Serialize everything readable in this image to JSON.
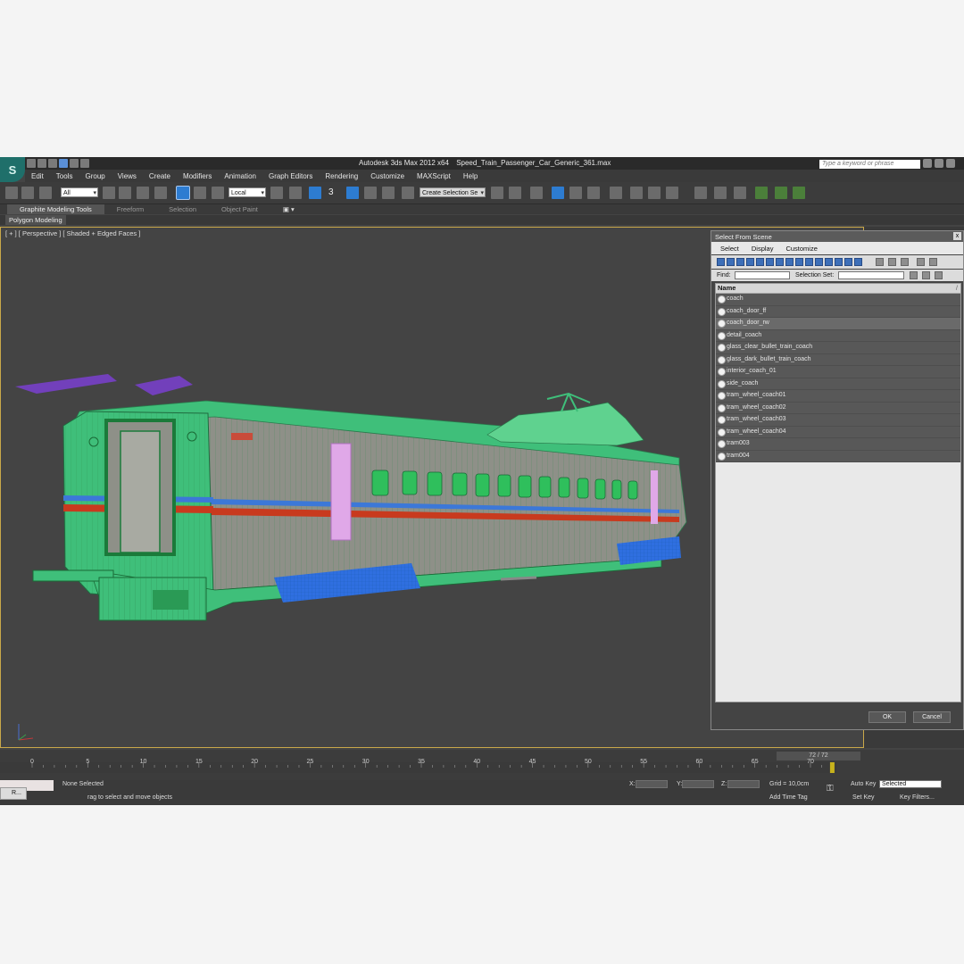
{
  "window": {
    "app_title": "Autodesk 3ds Max  2012 x64",
    "file_name": "Speed_Train_Passenger_Car_Generic_361.max",
    "search_placeholder": "Type a keyword or phrase"
  },
  "menu": [
    "Edit",
    "Tools",
    "Group",
    "Views",
    "Create",
    "Modifiers",
    "Animation",
    "Graph Editors",
    "Rendering",
    "Customize",
    "MAXScript",
    "Help"
  ],
  "toolbar": {
    "filter_value": "All",
    "coord_value": "Local",
    "selection_set_placeholder": "Create Selection Se",
    "snap_label": "3"
  },
  "ribbon": {
    "tabs": [
      "Graphite Modeling Tools",
      "Freeform",
      "Selection",
      "Object Paint"
    ],
    "panel": "Polygon Modeling"
  },
  "viewport": {
    "label": "[ + ] [ Perspective ] [ Shaded + Edged Faces ]"
  },
  "dialog": {
    "title": "Select From Scene",
    "close_glyph": "x",
    "menu": [
      "Select",
      "Display",
      "Customize"
    ],
    "find_label": "Find:",
    "selection_set_label": "Selection Set:",
    "column_header": "Name",
    "sort_glyph": "/",
    "highlighted_index": 2,
    "items": [
      "coach",
      "coach_door_ff",
      "coach_door_rw",
      "detail_coach",
      "glass_clear_bullet_train_coach",
      "glass_dark_bullet_train_coach",
      "interior_coach_01",
      "side_coach",
      "tram_wheel_coach01",
      "tram_wheel_coach02",
      "tram_wheel_coach03",
      "tram_wheel_coach04",
      "tram003",
      "tram004"
    ],
    "ok_label": "OK",
    "cancel_label": "Cancel"
  },
  "timeline": {
    "frame_readout": "72 / 72",
    "ticks": [
      "0",
      "5",
      "10",
      "15",
      "20",
      "25",
      "30",
      "35",
      "40",
      "45",
      "50",
      "55",
      "60",
      "65",
      "70"
    ],
    "current_frame": 72,
    "total_frames": 72
  },
  "status": {
    "selection": "None Selected",
    "prompt": "rag to select and move objects",
    "x_label": "X:",
    "y_label": "Y:",
    "z_label": "Z:",
    "grid": "Grid = 10,0cm",
    "add_time_tag": "Add Time Tag",
    "auto_key": "Auto Key",
    "auto_key_mode": "Selected",
    "set_key": "Set Key",
    "key_filters": "Key Filters...",
    "taskbar_item": "R..."
  },
  "colors": {
    "mesh_green": "#3fbf7a",
    "mesh_gray": "#8e9088",
    "stripe_blue": "#3c78d8",
    "stripe_red": "#c83a1e",
    "bogie_blue": "#2f6fe0",
    "pantograph_purple": "#7a3fd0",
    "viewport_border": "#c9a84a",
    "door_pink": "#e0a8e8"
  }
}
